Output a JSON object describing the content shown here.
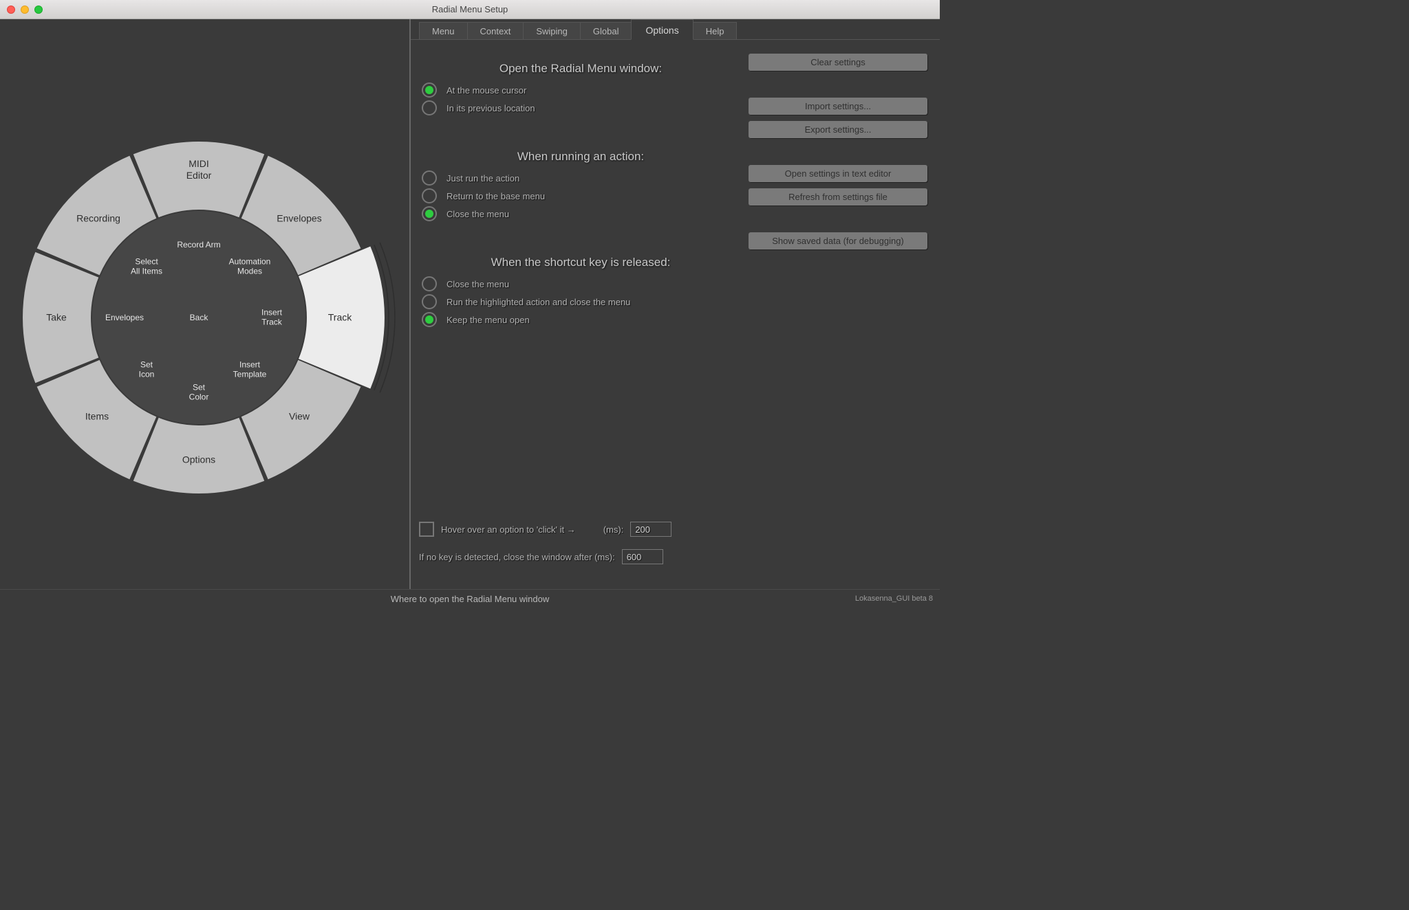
{
  "window": {
    "title": "Radial Menu Setup"
  },
  "tabs": {
    "t0": "Menu",
    "t1": "Context",
    "t2": "Swiping",
    "t3": "Global",
    "t4": "Options",
    "t5": "Help",
    "active": "Options"
  },
  "radial": {
    "outer": {
      "s0": "MIDI\nEditor",
      "s1": "Envelopes",
      "s2": "Track",
      "s3": "View",
      "s4": "Options",
      "s5": "Items",
      "s6": "Take",
      "s7": "Recording",
      "selected": "Track"
    },
    "inner": {
      "i0": "Record Arm",
      "i1": "Automation\nModes",
      "i2": "Insert\nTrack",
      "i3": "Insert\nTemplate",
      "i4": "Set\nColor",
      "i5": "Set\nIcon",
      "i6": "Envelopes",
      "i7": "Select\nAll Items",
      "center": "Back"
    }
  },
  "options": {
    "open_heading": "Open the Radial Menu window:",
    "open": {
      "o0": "At the mouse cursor",
      "o1": "In its previous location",
      "selected": 0
    },
    "action_heading": "When running an action:",
    "action": {
      "a0": "Just run the action",
      "a1": "Return to the base menu",
      "a2": "Close the menu",
      "selected": 2
    },
    "release_heading": "When the shortcut key is released:",
    "release": {
      "r0": "Close the menu",
      "r1": "Run the highlighted action and close the menu",
      "r2": "Keep the menu open",
      "selected": 2
    },
    "hover_label": "Hover over an option to 'click' it →",
    "hover_ms_label": "(ms):",
    "hover_ms": "200",
    "nokey_label": "If no key is detected, close the window after (ms):",
    "nokey_ms": "600"
  },
  "buttons": {
    "clear": "Clear settings",
    "import": "Import settings...",
    "export": "Export settings...",
    "open_text": "Open settings in text editor",
    "refresh": "Refresh from settings file",
    "debug": "Show saved data (for debugging)"
  },
  "status": {
    "hint": "Where to open the Radial Menu window",
    "credit": "Lokasenna_GUI beta 8"
  },
  "colors": {
    "radio_active": "#2ecc40",
    "ring_outer": "#c1c1c1",
    "ring_inner": "#464646",
    "selected_seg": "#ececec"
  }
}
